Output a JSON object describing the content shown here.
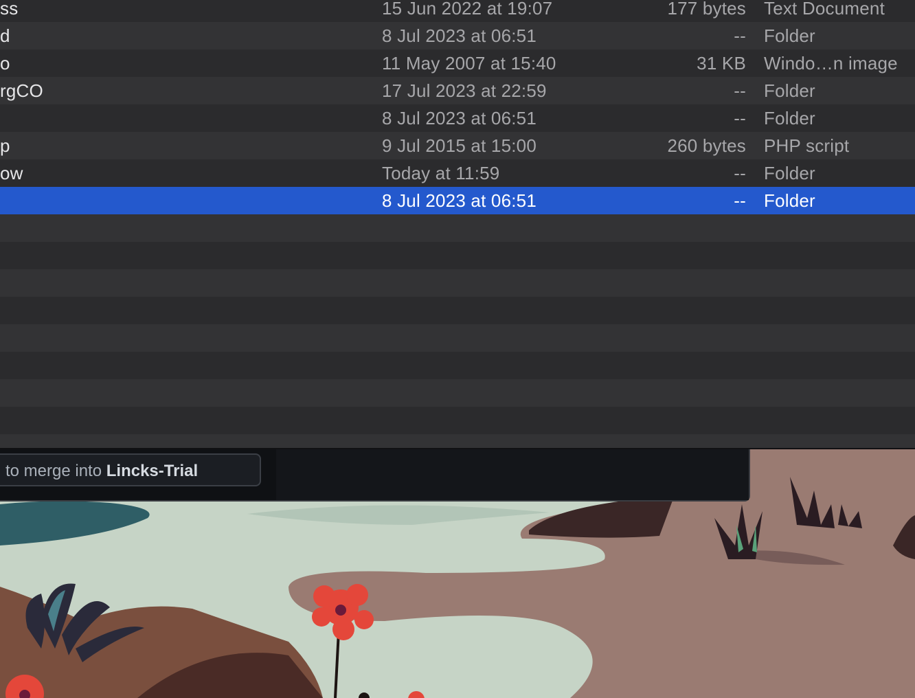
{
  "file_list": {
    "rows": [
      {
        "name": "ss",
        "date": "15 Jun 2022 at 19:07",
        "size": "177 bytes",
        "kind": "Text Document"
      },
      {
        "name": "d",
        "date": "8 Jul 2023 at 06:51",
        "size": "--",
        "kind": "Folder"
      },
      {
        "name": "o",
        "date": "11 May 2007 at 15:40",
        "size": "31 KB",
        "kind": "Windo…n image"
      },
      {
        "name": "rgCO",
        "date": "17 Jul 2023 at 22:59",
        "size": "--",
        "kind": "Folder"
      },
      {
        "name": "",
        "date": "8 Jul 2023 at 06:51",
        "size": "--",
        "kind": "Folder"
      },
      {
        "name": "p",
        "date": "9 Jul 2015 at 15:00",
        "size": "260 bytes",
        "kind": "PHP script"
      },
      {
        "name": "ow",
        "date": "Today at 11:59",
        "size": "--",
        "kind": "Folder"
      },
      {
        "name": "",
        "date": "8 Jul 2023 at 06:51",
        "size": "--",
        "kind": "Folder"
      }
    ],
    "selected_index": 7
  },
  "merge_panel": {
    "prefix": "to merge into ",
    "branch": "Lincks-Trial"
  },
  "colors": {
    "selection": "#2459cd",
    "row_odd": "#2b2b2d",
    "row_even": "#333335"
  }
}
